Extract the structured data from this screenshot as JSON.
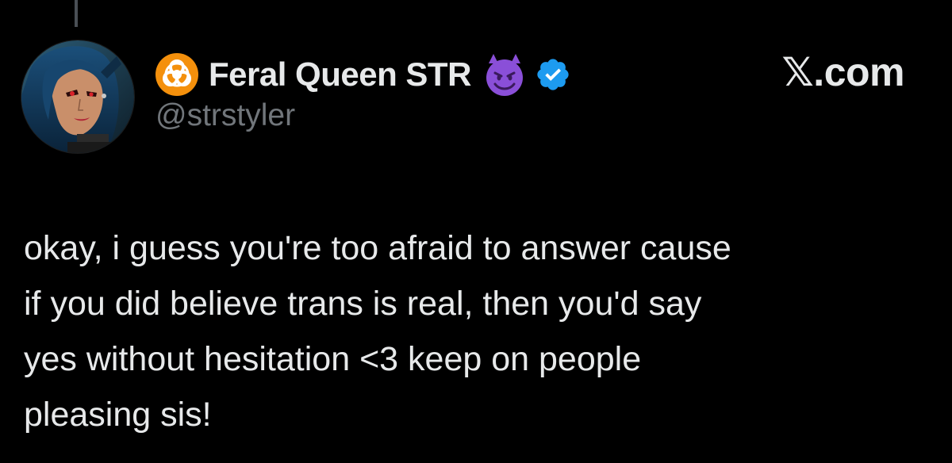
{
  "tweet": {
    "author": {
      "display_name": "Feral Queen STR",
      "handle": "@strstyler",
      "name_prefix_icon": "biohazard-icon",
      "name_suffix_icon": "smiling-devil-icon",
      "verified": true,
      "verified_color": "#1d9bf0"
    },
    "site_label": "𝕏.com",
    "text": "okay, i guess you're too afraid to answer cause\nif you did believe trans is real, then you'd say\nyes without hesitation <3 keep on people\npleasing sis!"
  },
  "colors": {
    "background": "#000000",
    "primary_text": "#e7e9ea",
    "secondary_text": "#71767b",
    "biohazard_orange": "#f4900c",
    "devil_purple": "#8a4fd8"
  }
}
